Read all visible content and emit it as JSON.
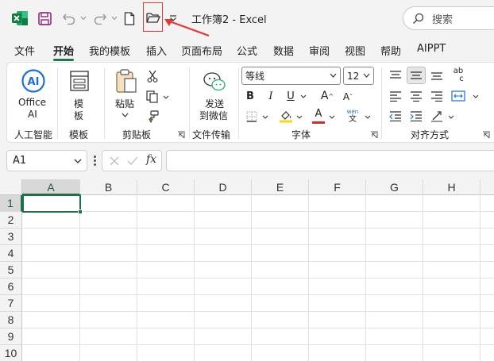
{
  "title_bar": {
    "doc_title": "工作簿2 - Excel",
    "search_placeholder": "搜索",
    "quick_access": [
      "save-icon",
      "undo-icon",
      "redo-icon",
      "new-document-icon",
      "open-folder-icon",
      "customize-quick-access-icon"
    ]
  },
  "tabs": [
    "文件",
    "开始",
    "我的模板",
    "插入",
    "页面布局",
    "公式",
    "数据",
    "审阅",
    "视图",
    "帮助",
    "AIPPT"
  ],
  "active_tab": "开始",
  "ribbon": {
    "ai": {
      "btn1": "Office",
      "btn2": "AI",
      "group": "人工智能"
    },
    "template": {
      "btn1": "模",
      "btn2": "板",
      "group": "模板"
    },
    "clipboard": {
      "paste": "粘贴",
      "group": "剪贴板"
    },
    "transfer": {
      "btn1": "发送",
      "btn2": "到微信",
      "group": "文件传输"
    },
    "font": {
      "name": "等线",
      "size": "12",
      "bold": "B",
      "italic": "I",
      "underline": "U",
      "grow": "A",
      "shrink": "A",
      "color_a": "A",
      "phonetic_top": "wén",
      "phonetic_bottom": "文",
      "group": "字体"
    },
    "align": {
      "group": "对齐方式",
      "wrap_top": "ab",
      "wrap_bottom": "c"
    }
  },
  "formula_bar": {
    "name_box": "A1",
    "cancel_icon": "close-icon",
    "enter_icon": "check-icon",
    "fx": "fx",
    "formula": ""
  },
  "grid": {
    "columns": [
      "A",
      "B",
      "C",
      "D",
      "E",
      "F",
      "G",
      "H"
    ],
    "rows": [
      "1",
      "2",
      "3",
      "4",
      "5",
      "6",
      "7",
      "8",
      "9",
      "10"
    ],
    "selected_cell": "A1"
  },
  "colors": {
    "excel_green": "#1e7145",
    "highlight": "#e53935",
    "fill_yellow": "#f5e000",
    "font_red": "#d32f2f"
  }
}
